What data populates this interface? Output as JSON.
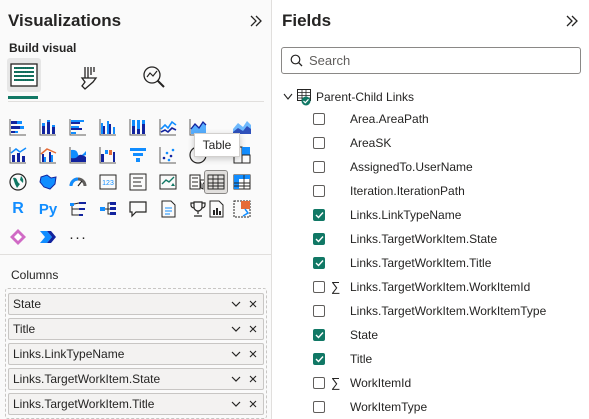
{
  "visualizations": {
    "title": "Visualizations",
    "build_visual_label": "Build visual",
    "tabs": [
      {
        "id": "build-visual",
        "icon": "build-visual-icon",
        "active": true
      },
      {
        "id": "format-visual",
        "icon": "paintbrush-icon",
        "active": false
      },
      {
        "id": "analytics",
        "icon": "analytics-icon",
        "active": false
      }
    ],
    "tooltip": "Table",
    "columns_label": "Columns",
    "columns": [
      {
        "label": "State"
      },
      {
        "label": "Title"
      },
      {
        "label": "Links.LinkTypeName"
      },
      {
        "label": "Links.TargetWorkItem.State"
      },
      {
        "label": "Links.TargetWorkItem.Title"
      }
    ],
    "more_visuals_glyph": "···"
  },
  "fields": {
    "title": "Fields",
    "search_placeholder": "Search",
    "table_name": "Parent-Child Links",
    "items": [
      {
        "label": "Area.AreaPath",
        "checked": false,
        "sigma": false
      },
      {
        "label": "AreaSK",
        "checked": false,
        "sigma": false
      },
      {
        "label": "AssignedTo.UserName",
        "checked": false,
        "sigma": false
      },
      {
        "label": "Iteration.IterationPath",
        "checked": false,
        "sigma": false
      },
      {
        "label": "Links.LinkTypeName",
        "checked": true,
        "sigma": false
      },
      {
        "label": "Links.TargetWorkItem.State",
        "checked": true,
        "sigma": false
      },
      {
        "label": "Links.TargetWorkItem.Title",
        "checked": true,
        "sigma": false
      },
      {
        "label": "Links.TargetWorkItem.WorkItemId",
        "checked": false,
        "sigma": true
      },
      {
        "label": "Links.TargetWorkItem.WorkItemType",
        "checked": false,
        "sigma": false
      },
      {
        "label": "State",
        "checked": true,
        "sigma": false
      },
      {
        "label": "Title",
        "checked": true,
        "sigma": false
      },
      {
        "label": "WorkItemId",
        "checked": false,
        "sigma": true
      },
      {
        "label": "WorkItemType",
        "checked": false,
        "sigma": false
      }
    ]
  },
  "colors": {
    "accent": "#117865",
    "chart_blue": "#118dff",
    "chart_dark": "#12239e",
    "chart_orange": "#e66c37"
  }
}
